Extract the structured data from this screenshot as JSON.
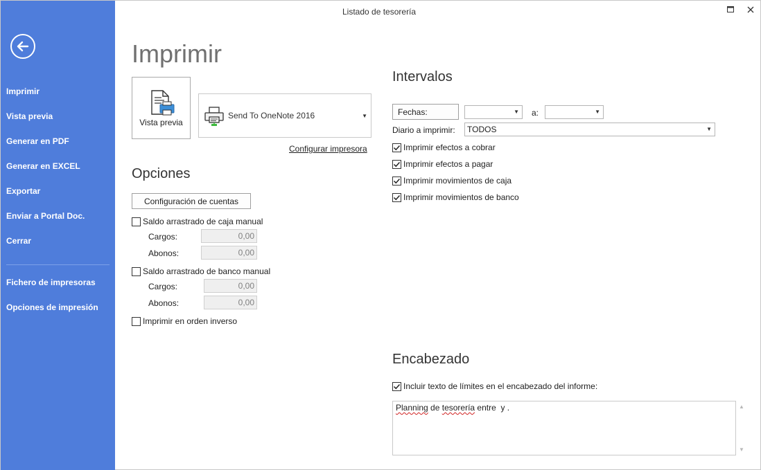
{
  "window": {
    "title": "Listado de tesorería",
    "maximize_glyph": "🗖",
    "close_glyph": "✕"
  },
  "sidebar": {
    "back_icon": "back-arrow-icon",
    "items": [
      {
        "label": "Imprimir"
      },
      {
        "label": "Vista previa"
      },
      {
        "label": "Generar en PDF"
      },
      {
        "label": "Generar en EXCEL"
      },
      {
        "label": "Exportar"
      },
      {
        "label": "Enviar a Portal Doc."
      },
      {
        "label": "Cerrar"
      },
      {
        "label": "Fichero de impresoras"
      },
      {
        "label": "Opciones de impresión"
      }
    ],
    "colors": {
      "background": "#4f7ddb"
    }
  },
  "print": {
    "title": "Imprimir",
    "preview_label": "Vista previa",
    "printer_name": "Send To OneNote 2016",
    "configure_printer": "Configurar impresora"
  },
  "opciones": {
    "title": "Opciones",
    "config_button": "Configuración de cuentas",
    "caja_check": {
      "label": "Saldo arrastrado de caja manual",
      "checked": false
    },
    "caja_cargos_label": "Cargos:",
    "caja_cargos_value": "0,00",
    "caja_abonos_label": "Abonos:",
    "caja_abonos_value": "0,00",
    "banco_check": {
      "label": "Saldo arrastrado de banco manual",
      "checked": false
    },
    "banco_cargos_label": "Cargos:",
    "banco_cargos_value": "0,00",
    "banco_abonos_label": "Abonos:",
    "banco_abonos_value": "0,00",
    "inverso_check": {
      "label": "Imprimir en orden inverso",
      "checked": false
    }
  },
  "intervalos": {
    "title": "Intervalos",
    "fechas_button": "Fechas:",
    "fecha_desde": "",
    "a_label": "a:",
    "fecha_hasta": "",
    "diario_label": "Diario a imprimir:",
    "diario_value": "TODOS",
    "checks": [
      {
        "label": "Imprimir efectos a cobrar",
        "checked": true
      },
      {
        "label": "Imprimir efectos a pagar",
        "checked": true
      },
      {
        "label": "Imprimir movimientos de caja",
        "checked": true
      },
      {
        "label": "Imprimir movimientos de banco",
        "checked": true
      }
    ]
  },
  "encabezado": {
    "title": "Encabezado",
    "include_check": {
      "label": "Incluir texto de límites en el encabezado del informe:",
      "checked": true
    },
    "text_word1": "Planning",
    "text_mid": " de ",
    "text_word2": "tesorería",
    "text_rest": " entre  y ."
  }
}
